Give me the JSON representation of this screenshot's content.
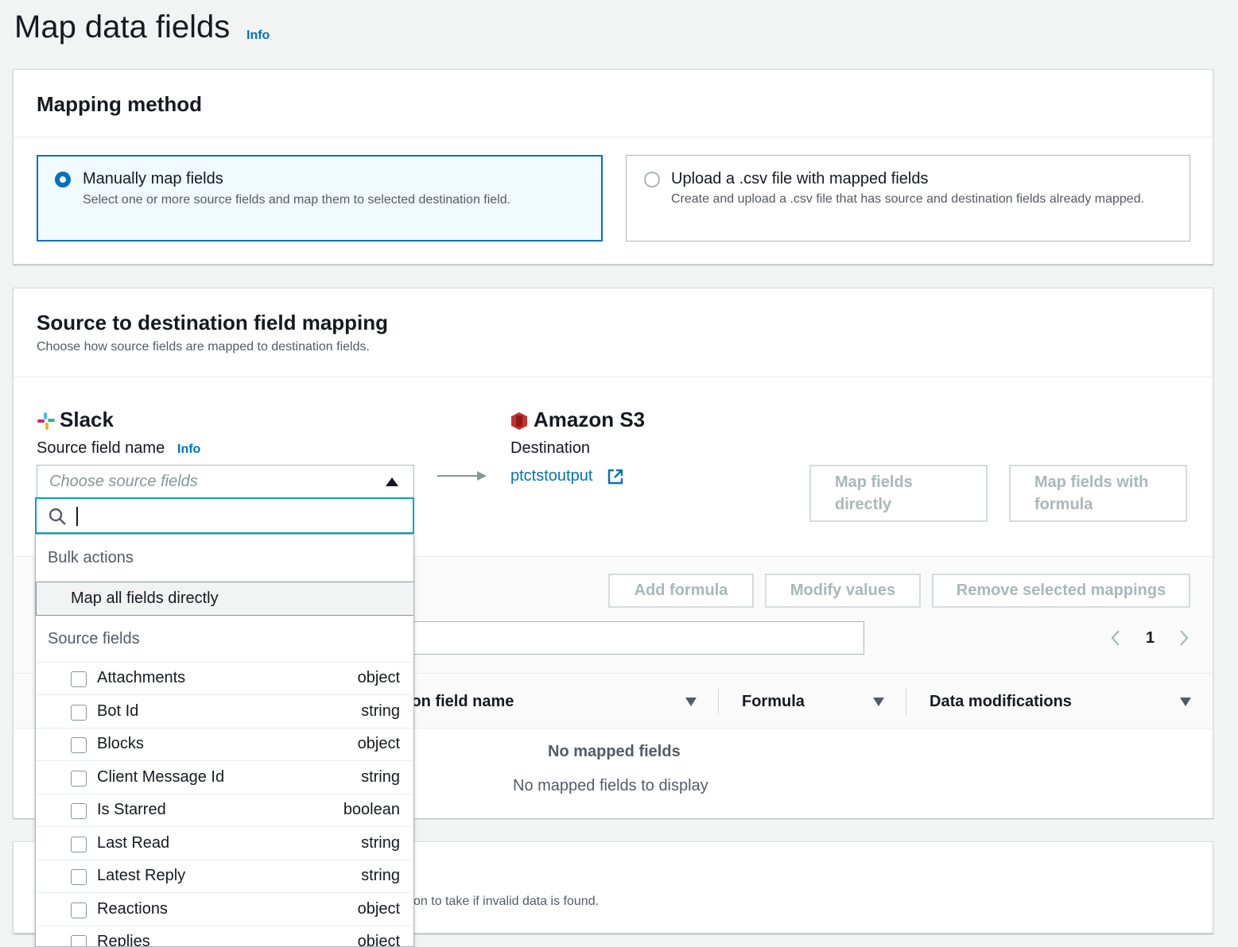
{
  "page": {
    "title": "Map data fields",
    "info": "Info"
  },
  "mapping_method": {
    "heading": "Mapping method",
    "options": [
      {
        "title": "Manually map fields",
        "description": "Select one or more source fields and map them to selected destination field.",
        "selected": true
      },
      {
        "title": "Upload a .csv file with mapped fields",
        "description": "Create and upload a .csv file that has source and destination fields already mapped.",
        "selected": false
      }
    ]
  },
  "field_mapping": {
    "heading": "Source to destination field mapping",
    "description": "Choose how source fields are mapped to destination fields.",
    "source": {
      "app": "Slack",
      "label": "Source field name",
      "info": "Info",
      "placeholder": "Choose source fields"
    },
    "destination": {
      "app": "Amazon S3",
      "label": "Destination",
      "link": "ptctstoutput"
    },
    "buttons": {
      "map_directly": "Map fields directly",
      "map_formula": "Map fields with formula"
    },
    "actions": {
      "add_formula": "Add formula",
      "modify_values": "Modify values",
      "remove": "Remove selected mappings"
    },
    "pagination": {
      "page": "1"
    },
    "table": {
      "columns": [
        "Destination field name",
        "Formula",
        "Data modifications"
      ],
      "empty_title": "No mapped fields",
      "empty_desc": "No mapped fields to display"
    }
  },
  "dropdown": {
    "bulk_label": "Bulk actions",
    "bulk_item": "Map all fields directly",
    "fields_label": "Source fields",
    "fields": [
      {
        "name": "Attachments",
        "type": "object"
      },
      {
        "name": "Bot Id",
        "type": "string"
      },
      {
        "name": "Blocks",
        "type": "object"
      },
      {
        "name": "Client Message Id",
        "type": "string"
      },
      {
        "name": "Is Starred",
        "type": "boolean"
      },
      {
        "name": "Last Read",
        "type": "string"
      },
      {
        "name": "Latest Reply",
        "type": "string"
      },
      {
        "name": "Reactions",
        "type": "object"
      },
      {
        "name": "Replies",
        "type": "object"
      }
    ]
  },
  "validation": {
    "description_fragment": "on to take if invalid data is found."
  },
  "colors": {
    "accent": "#0073bb",
    "slack": "#e01e5a",
    "s3": "#c7332c"
  }
}
